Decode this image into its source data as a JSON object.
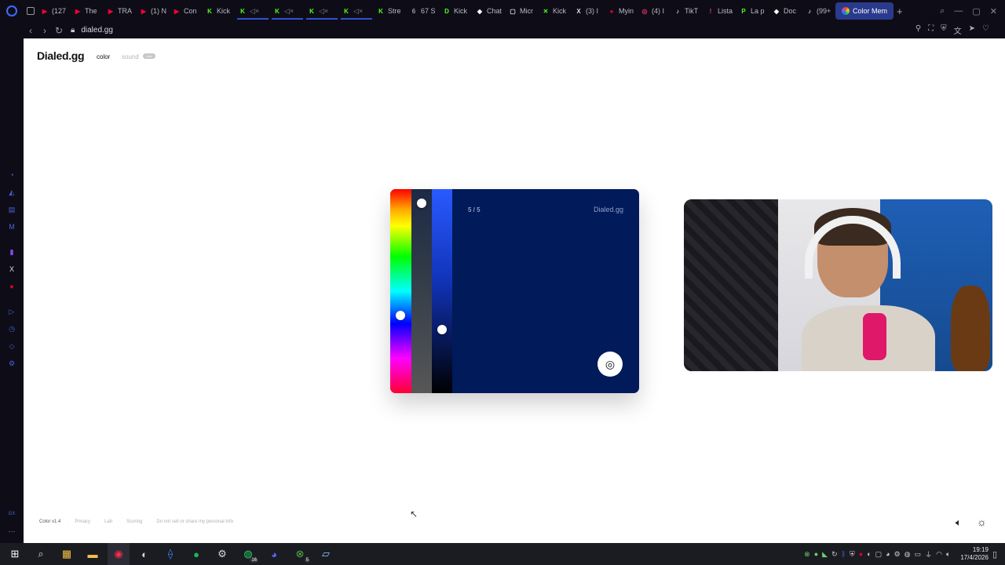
{
  "browser": {
    "tabs": [
      {
        "label": "(127",
        "color": "#ff0033",
        "glyph": "▶"
      },
      {
        "label": "The",
        "color": "#ff0033",
        "glyph": "▶"
      },
      {
        "label": "TRA",
        "color": "#ff0033",
        "glyph": "▶"
      },
      {
        "label": "(1) N",
        "color": "#ff0033",
        "glyph": "▶"
      },
      {
        "label": "Con",
        "color": "#ff0033",
        "glyph": "▶"
      },
      {
        "label": "Kick",
        "color": "#53fc18",
        "glyph": "K"
      },
      {
        "label": "",
        "color": "#53fc18",
        "glyph": "K",
        "muted": true
      },
      {
        "label": "",
        "color": "#53fc18",
        "glyph": "K",
        "muted": true
      },
      {
        "label": "",
        "color": "#53fc18",
        "glyph": "K",
        "muted": true
      },
      {
        "label": "",
        "color": "#53fc18",
        "glyph": "K",
        "muted": true
      },
      {
        "label": "Stre",
        "color": "#53fc18",
        "glyph": "K"
      },
      {
        "label": "67 S",
        "color": "#9b9b9b",
        "glyph": "6"
      },
      {
        "label": "Kick",
        "color": "#53fc18",
        "glyph": "D"
      },
      {
        "label": "Chat",
        "color": "#ffffff",
        "glyph": "◆"
      },
      {
        "label": "Micr",
        "color": "#dddddd",
        "glyph": "▢"
      },
      {
        "label": "Kick",
        "color": "#53fc18",
        "glyph": "✕"
      },
      {
        "label": "(3) I",
        "color": "#dddddd",
        "glyph": "X"
      },
      {
        "label": "Myin",
        "color": "#e0002a",
        "glyph": "●"
      },
      {
        "label": "(4) I",
        "color": "#e1306c",
        "glyph": "◎"
      },
      {
        "label": "TikT",
        "color": "#ffffff",
        "glyph": "♪"
      },
      {
        "label": "Lista",
        "color": "#ff3377",
        "glyph": "!"
      },
      {
        "label": "La p",
        "color": "#53fc18",
        "glyph": "P"
      },
      {
        "label": "Doc",
        "color": "#ffffff",
        "glyph": "◆"
      },
      {
        "label": "(99+",
        "color": "#ffffff",
        "glyph": "♪"
      }
    ],
    "active_tab": {
      "label": "Color Mem",
      "color": "#ff6a00"
    },
    "url": "dialed.gg"
  },
  "site": {
    "brand": "Dialed.gg",
    "nav_color": "color",
    "nav_sound": "sound",
    "new_badge": "new"
  },
  "game": {
    "counter": "5 / 5",
    "brand": "Dialed.gg",
    "color": "#001a5a",
    "hue_position": 0.62,
    "saturation_position": 0.07,
    "lightness_position": 0.69
  },
  "footer": {
    "version": "Color v1.4",
    "links": [
      "Privacy",
      "Lab",
      "Scoring",
      "Do not sell or share my personal info"
    ]
  },
  "taskbar": {
    "whatsapp_badge": "16",
    "xbox_badge": "5",
    "time": "19:19",
    "date": "17/4/2026"
  }
}
